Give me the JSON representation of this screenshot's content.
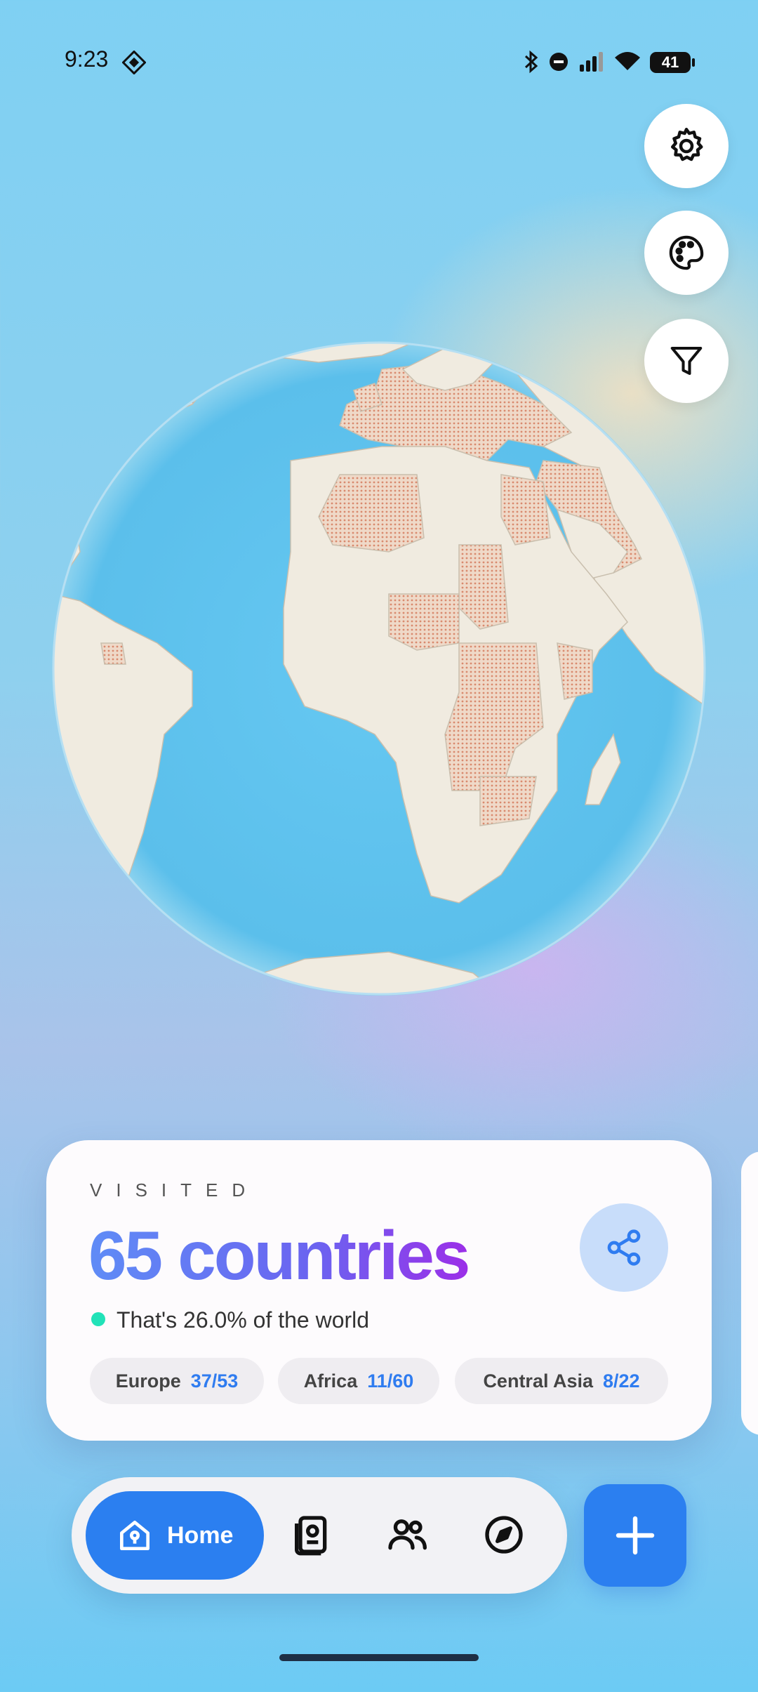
{
  "status_bar": {
    "time": "9:23",
    "battery": "41"
  },
  "side_buttons": [
    {
      "icon": "gear-icon"
    },
    {
      "icon": "palette-icon"
    },
    {
      "icon": "filter-icon"
    }
  ],
  "stats_card": {
    "label": "VISITED",
    "count_text": "65 countries",
    "percent_text": "That's 26.0% of the world",
    "regions": [
      {
        "name": "Europe",
        "count": "37/53"
      },
      {
        "name": "Africa",
        "count": "11/60"
      },
      {
        "name": "Central Asia",
        "count": "8/22"
      }
    ]
  },
  "nav": {
    "home_label": "Home"
  },
  "colors": {
    "accent": "#2b7ff0",
    "ocean": "#62c4ef",
    "land": "#f0ebe0",
    "visited": "#e5a98d"
  }
}
